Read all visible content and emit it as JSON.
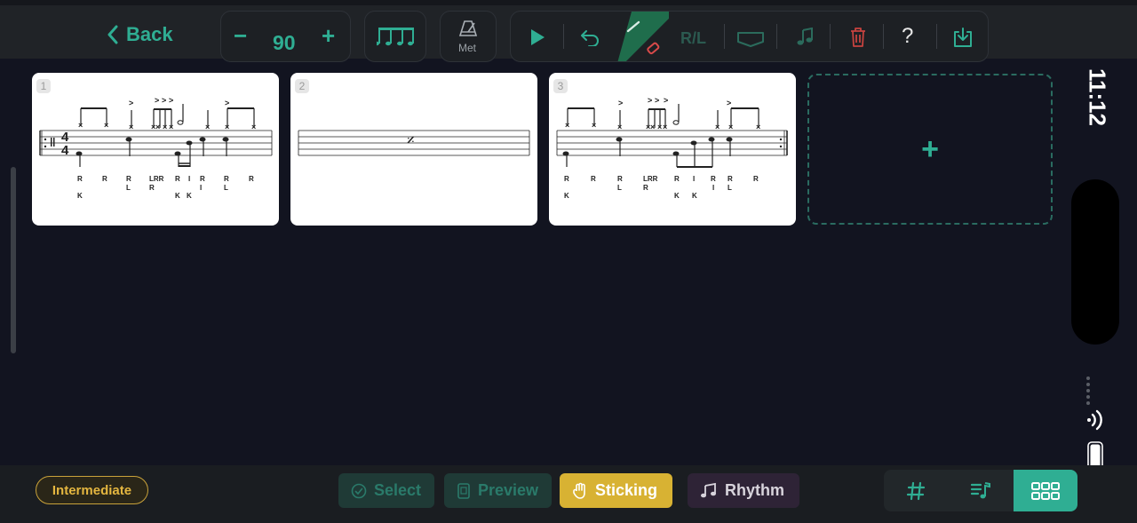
{
  "toolbar": {
    "back_label": "Back",
    "tempo_value": "90",
    "metronome_label": "Met",
    "rl_label": "R/L",
    "help_label": "?"
  },
  "measures": [
    {
      "number": "1",
      "stickings": [
        "R",
        "R",
        "R",
        "L",
        "R",
        "R",
        "R",
        "I",
        "R",
        "R"
      ],
      "lower": [
        "K",
        "L",
        "R",
        "K",
        "K",
        "I",
        "L"
      ]
    },
    {
      "number": "2",
      "repeat_symbol": "𝄎"
    },
    {
      "number": "3",
      "stickings": [
        "R",
        "R",
        "R",
        "L",
        "R",
        "R",
        "R",
        "I",
        "R",
        "R"
      ],
      "lower": [
        "K",
        "L",
        "R",
        "K",
        "K",
        "I",
        "L"
      ]
    }
  ],
  "add_measure_label": "+",
  "status": {
    "time": "11:12"
  },
  "bottom": {
    "level_label": "Intermediate",
    "modes": [
      {
        "label": "Select"
      },
      {
        "label": "Preview"
      },
      {
        "label": "Sticking"
      },
      {
        "label": "Rhythm"
      }
    ]
  },
  "colors": {
    "accent": "#2fae93",
    "sticking": "#d8b233",
    "level": "#e4b640",
    "background": "#121420"
  }
}
